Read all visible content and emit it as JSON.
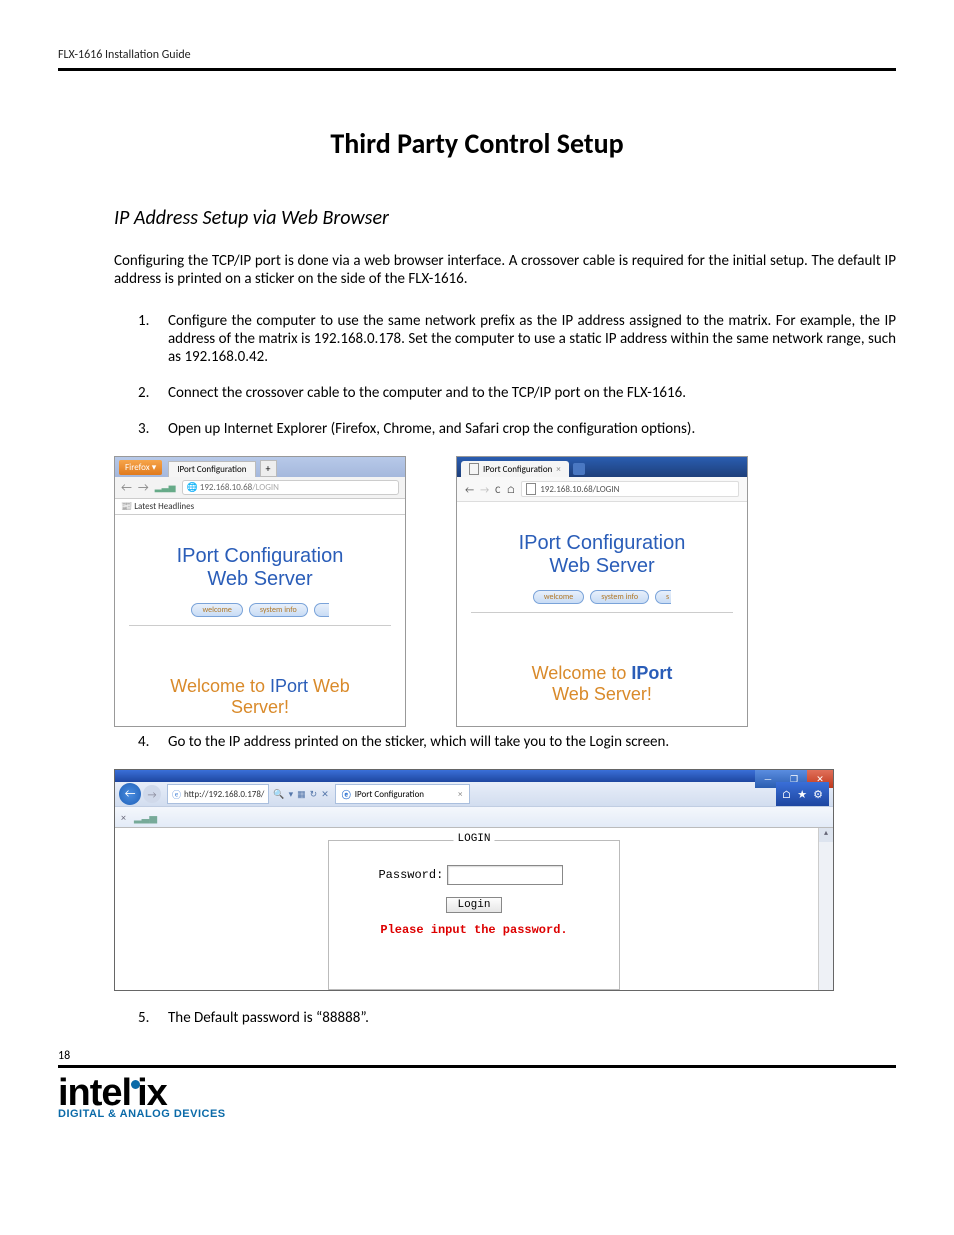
{
  "header": "FLX-1616 Installation Guide",
  "title": "Third Party Control Setup",
  "subhead": "IP Address Setup via Web Browser",
  "intro": "Configuring the TCP/IP port is done via a web browser interface. A crossover cable is required for the initial setup. The default IP address is printed on a sticker on the side of the FLX-1616.",
  "steps": {
    "s1": "Configure the computer to use the same network prefix as the IP address assigned to the matrix. For example, the IP address of the matrix is 192.168.0.178. Set the computer to use a static IP address within the same network range, such as 192.168.0.42.",
    "s2": "Connect the crossover cable to the computer and to the TCP/IP port on the FLX-1616.",
    "s3": "Open up Internet Explorer (Firefox, Chrome, and Safari crop the configuration options).",
    "s4": "Go to the IP address printed on the sticker, which will take you to the Login screen.",
    "s5": "The Default password is “88888”."
  },
  "firefox": {
    "brand": "Firefox",
    "tab": "IPort Configuration",
    "url_host": "192.168.10.68",
    "url_path": "/LOGIN",
    "bookmark": "Latest Headlines"
  },
  "chrome": {
    "tab": "IPort Configuration",
    "url": "192.168.10.68/LOGIN"
  },
  "iport": {
    "title_l1": "IPort Configuration",
    "title_l2": "Web Server",
    "pill_welcome": "welcome",
    "pill_sysinfo": "system info",
    "welcome_pre": "Welcome to ",
    "welcome_brand": "IPort",
    "welcome_post": " Web Server!",
    "welcome_post_short": "Web Server!"
  },
  "ie": {
    "url": "http://192.168.0.178/",
    "tab": "IPort Configuration",
    "login_legend": "LOGIN",
    "password_label": "Password:",
    "login_btn": "Login",
    "error": "Please input the password."
  },
  "page_number": "18",
  "logo": {
    "main": "intelix",
    "sub": "DIGITAL & ANALOG DEVICES"
  }
}
